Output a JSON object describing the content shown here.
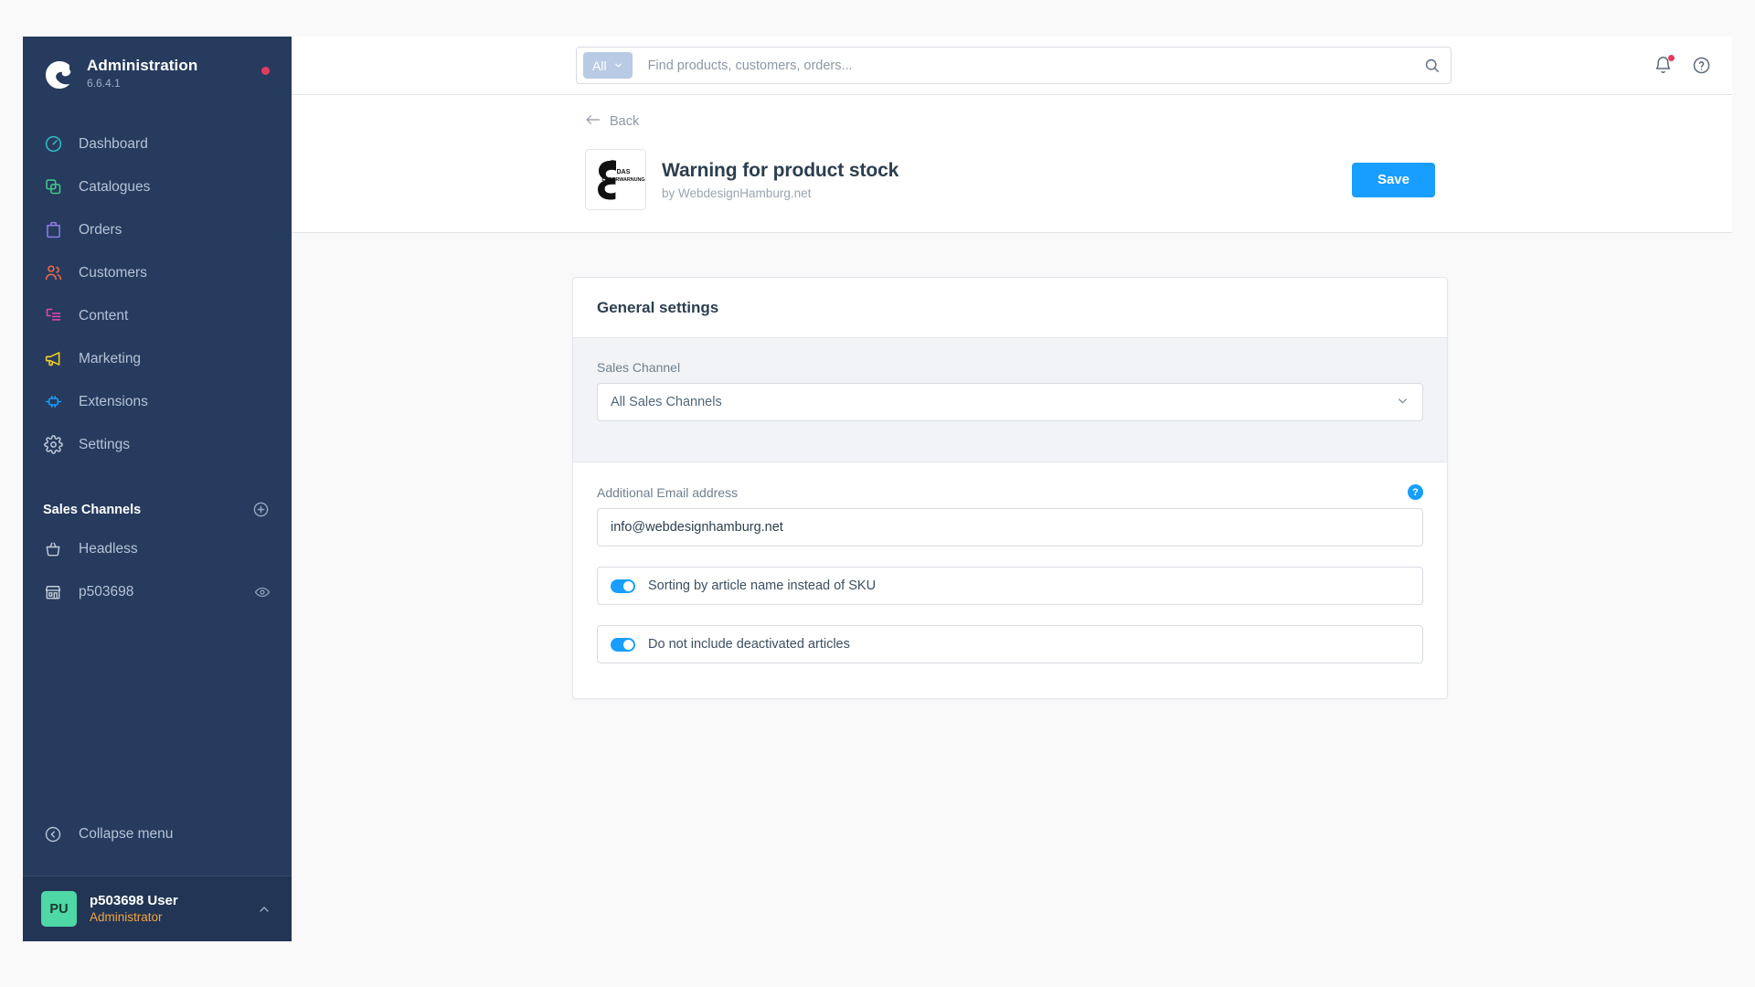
{
  "sidebar": {
    "brand": {
      "title": "Administration",
      "version": "6.6.4.1",
      "logo_icon": "shopware-logo-icon",
      "status_dot": "notification-dot"
    },
    "items": [
      {
        "label": "Dashboard",
        "icon": "dashboard-gauge-icon",
        "color": "#37b8c4"
      },
      {
        "label": "Catalogues",
        "icon": "catalogues-layers-icon",
        "color": "#3fc58a"
      },
      {
        "label": "Orders",
        "icon": "orders-bag-icon",
        "color": "#8c7ae6"
      },
      {
        "label": "Customers",
        "icon": "customers-people-icon",
        "color": "#f0674b"
      },
      {
        "label": "Content",
        "icon": "content-list-icon",
        "color": "#e845b0"
      },
      {
        "label": "Marketing",
        "icon": "marketing-megaphone-icon",
        "color": "#f5d020"
      },
      {
        "label": "Extensions",
        "icon": "extensions-plug-icon",
        "color": "#189eff"
      },
      {
        "label": "Settings",
        "icon": "settings-gear-icon",
        "color": "#c4ccd8"
      }
    ],
    "sales_channels": {
      "title": "Sales Channels",
      "add_icon": "plus-circle-icon",
      "items": [
        {
          "label": "Headless",
          "icon": "basket-icon",
          "has_eye": false
        },
        {
          "label": "p503698",
          "icon": "storefront-icon",
          "has_eye": true,
          "eye_icon": "eye-icon"
        }
      ]
    },
    "collapse": {
      "label": "Collapse menu",
      "icon": "collapse-left-icon"
    },
    "user": {
      "initials": "PU",
      "name": "p503698 User",
      "role": "Administrator",
      "caret_icon": "chevron-up-icon"
    }
  },
  "topbar": {
    "search": {
      "scope_label": "All",
      "scope_caret_icon": "chevron-down-icon",
      "placeholder": "Find products, customers, orders...",
      "value": "",
      "search_icon": "search-icon"
    },
    "notifications_icon": "bell-icon",
    "help_icon": "question-circle-icon",
    "has_notification": true
  },
  "page_header": {
    "back_label": "Back",
    "back_icon": "arrow-left-icon",
    "logo": {
      "icon": "plugin-logo-icon",
      "line1": "DAS",
      "line2": "LAGERWARNUNG"
    },
    "title": "Warning for product stock",
    "byline": "by WebdesignHamburg.net",
    "save_label": "Save"
  },
  "settings_card": {
    "heading": "General settings",
    "sales_channel": {
      "label": "Sales Channel",
      "value": "All Sales Channels",
      "caret_icon": "chevron-down-icon"
    },
    "email": {
      "label": "Additional Email address",
      "value": "info@webdesignhamburg.net",
      "placeholder": "",
      "help_icon": "help-question-icon",
      "help_glyph": "?"
    },
    "toggles": [
      {
        "label": "Sorting by article name instead of SKU",
        "on": true
      },
      {
        "label": "Do not include deactivated articles",
        "on": true
      }
    ]
  },
  "colors": {
    "sidebar_bg": "#263b5e",
    "accent": "#189eff",
    "save_button": "#189eff",
    "avatar": "#4dd8a6",
    "role_text": "#f0a441",
    "alert_dot": "#e5395e"
  }
}
